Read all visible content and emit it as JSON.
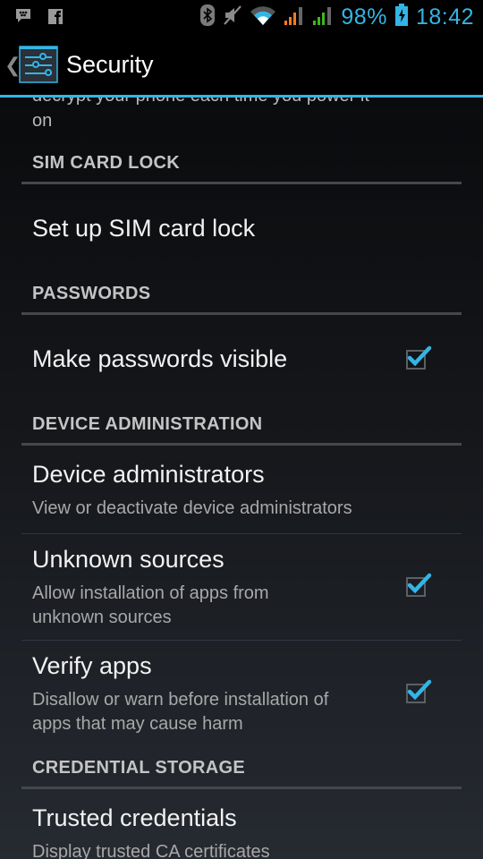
{
  "status_bar": {
    "left_icons": [
      "bbm-icon",
      "facebook-icon"
    ],
    "right_icons": [
      "bluetooth-icon",
      "mute-icon",
      "wifi-icon",
      "signal-sim1-icon",
      "signal-sim2-icon",
      "battery-charging-icon"
    ],
    "battery": "98%",
    "time": "18:42",
    "accent_color": "#33b5e5"
  },
  "action_bar": {
    "title": "Security",
    "icon": "settings-sliders-icon"
  },
  "partial_item": {
    "summary_line1": "decrypt your phone each time you power it",
    "summary_line2": "on"
  },
  "sections": {
    "sim": {
      "header": "SIM CARD LOCK",
      "items": [
        {
          "title": "Set up SIM card lock"
        }
      ]
    },
    "passwords": {
      "header": "PASSWORDS",
      "items": [
        {
          "title": "Make passwords visible",
          "checked": true
        }
      ]
    },
    "device_admin": {
      "header": "DEVICE ADMINISTRATION",
      "items": [
        {
          "title": "Device administrators",
          "summary": "View or deactivate device administrators"
        },
        {
          "title": "Unknown sources",
          "summary": "Allow installation of apps from unknown sources",
          "checked": true
        },
        {
          "title": "Verify apps",
          "summary": "Disallow or warn before installation of apps that may cause harm",
          "checked": true
        }
      ]
    },
    "credentials": {
      "header": "CREDENTIAL STORAGE",
      "items": [
        {
          "title": "Trusted credentials",
          "summary": "Display trusted CA certificates"
        }
      ]
    }
  }
}
